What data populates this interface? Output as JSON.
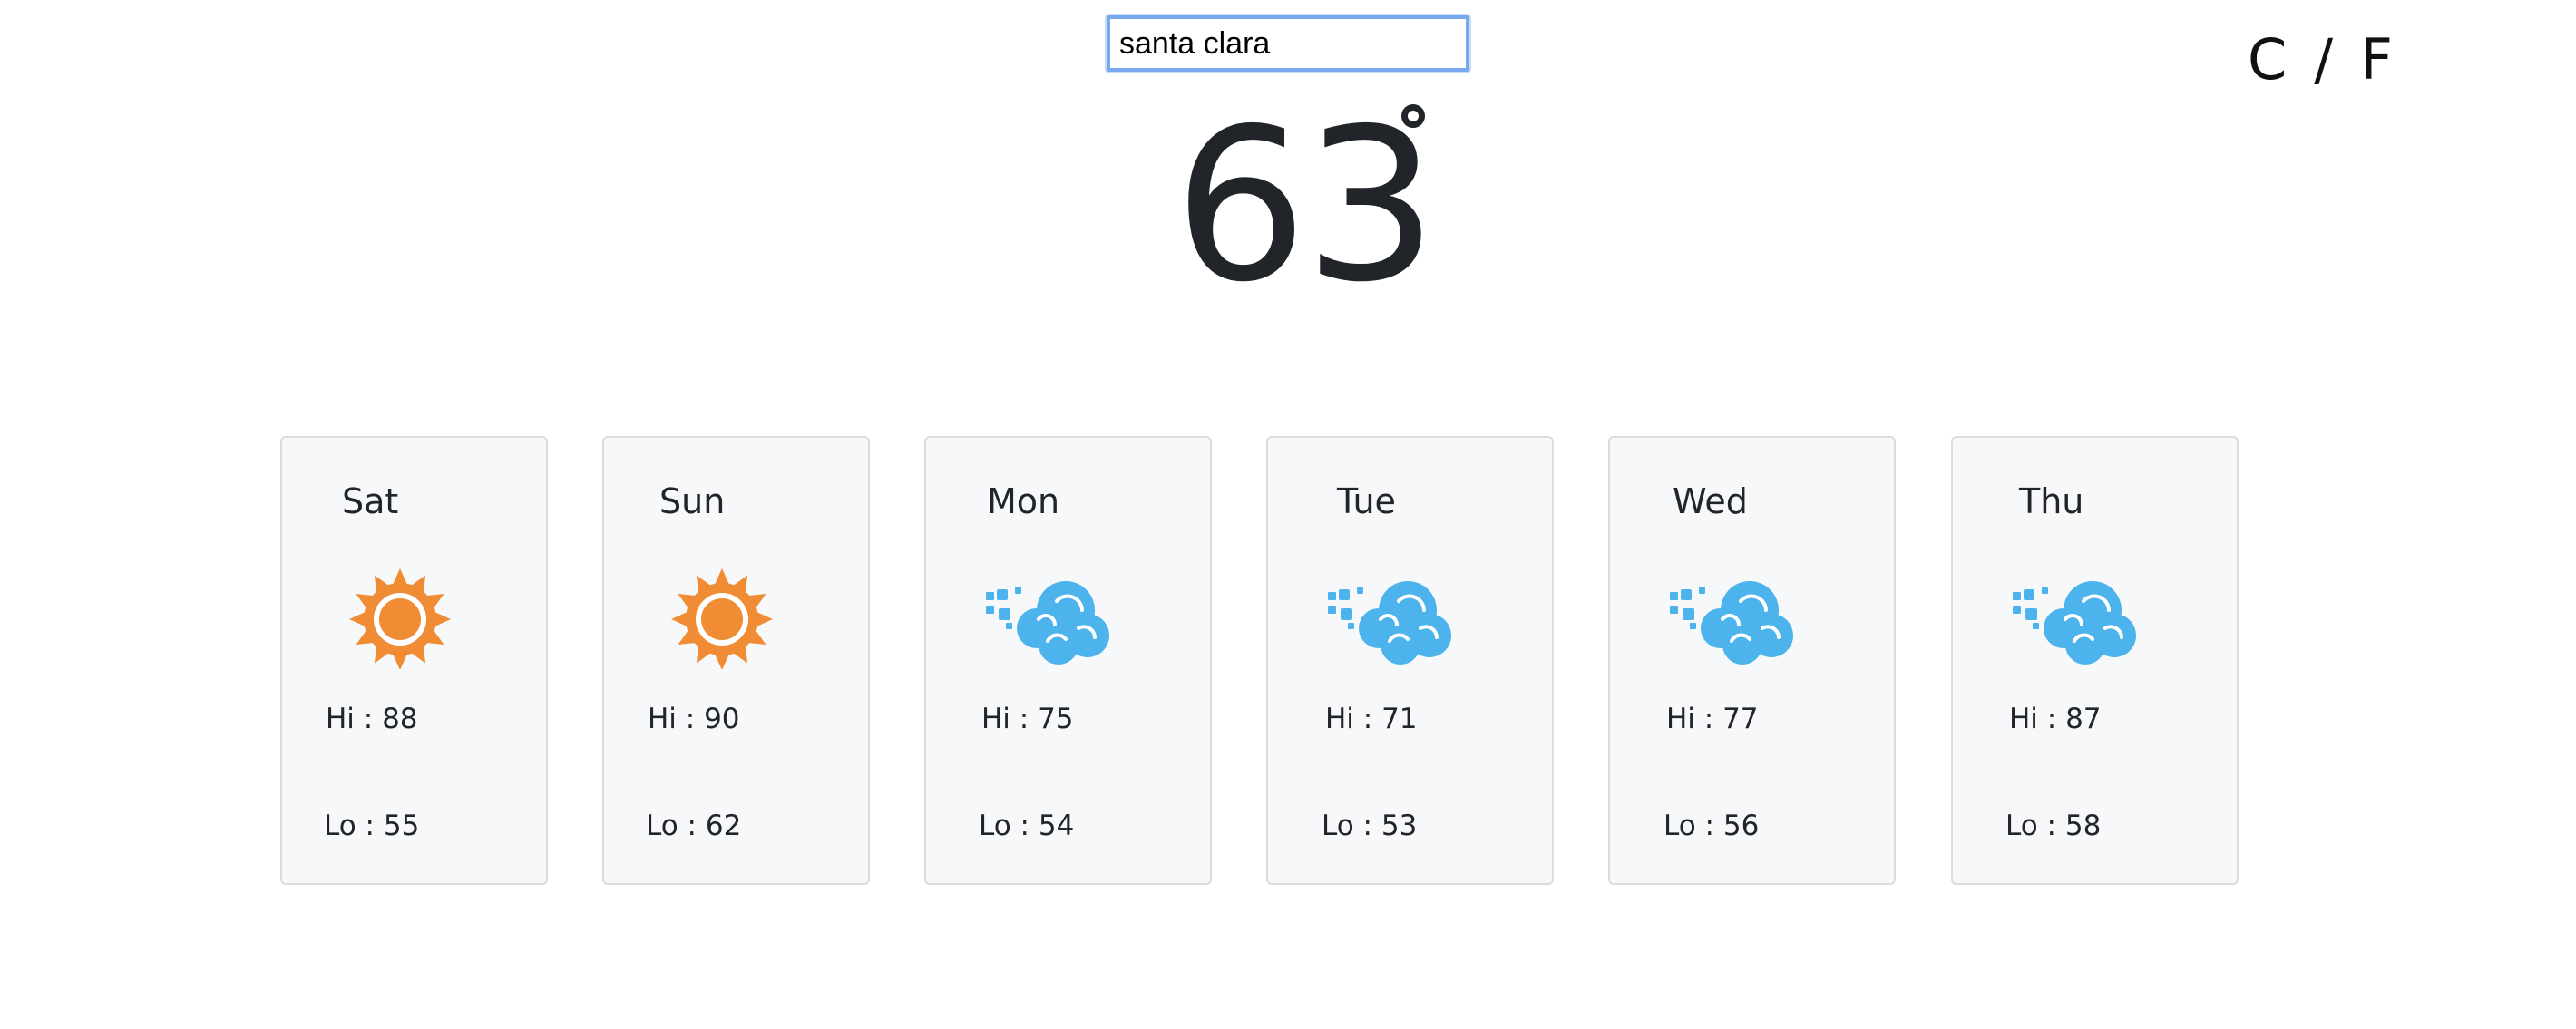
{
  "search": {
    "value": "santa clara"
  },
  "units": {
    "celsius": "C",
    "separator": "/",
    "fahrenheit": "F"
  },
  "current": {
    "temperature": "63"
  },
  "forecast": [
    {
      "day": "Sat",
      "icon": "sun-icon",
      "hi": "Hi : 88",
      "lo": "Lo : 55"
    },
    {
      "day": "Sun",
      "icon": "sun-icon",
      "hi": "Hi : 90",
      "lo": "Lo : 62"
    },
    {
      "day": "Mon",
      "icon": "windy-cloud-icon",
      "hi": "Hi : 75",
      "lo": "Lo : 54"
    },
    {
      "day": "Tue",
      "icon": "windy-cloud-icon",
      "hi": "Hi : 71",
      "lo": "Lo : 53"
    },
    {
      "day": "Wed",
      "icon": "windy-cloud-icon",
      "hi": "Hi : 77",
      "lo": "Lo : 56"
    },
    {
      "day": "Thu",
      "icon": "windy-cloud-icon",
      "hi": "Hi : 87",
      "lo": "Lo : 58"
    }
  ],
  "colors": {
    "sun": "#f08c33",
    "cloud": "#4db3ec",
    "input_border": "#78a9ec",
    "card_bg": "#f7f8f9",
    "card_border": "#dadde0",
    "text": "#212529"
  }
}
